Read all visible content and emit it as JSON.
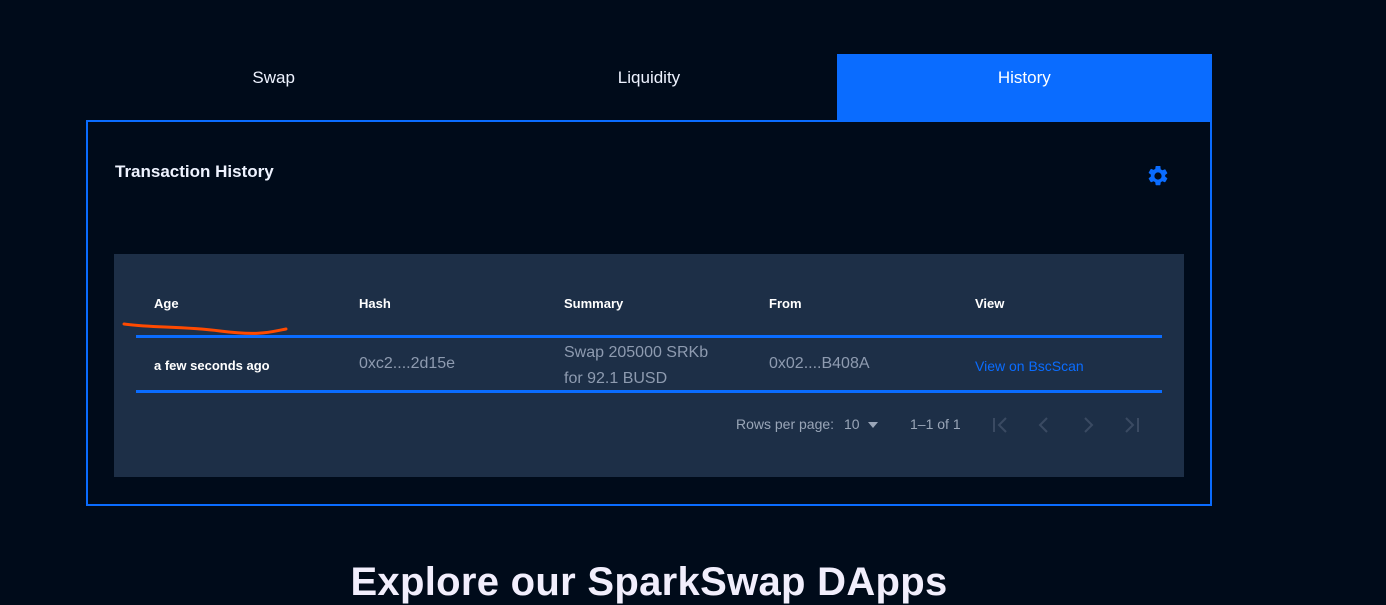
{
  "tabs": [
    {
      "label": "Swap"
    },
    {
      "label": "Liquidity"
    },
    {
      "label": "History"
    }
  ],
  "active_tab": "History",
  "panel": {
    "title": "Transaction History",
    "settings_icon": "gear-icon"
  },
  "table": {
    "columns": [
      "Age",
      "Hash",
      "Summary",
      "From",
      "View"
    ],
    "rows": [
      {
        "age": "a few seconds ago",
        "hash": "0xc2....2d15e",
        "summary_line1": "Swap 205000 SRKb",
        "summary_line2": "for 92.1 BUSD",
        "from": "0x02....B408A",
        "view": "View on BscScan"
      }
    ],
    "pagination": {
      "rows_per_page_label": "Rows per page:",
      "rows_per_page_value": "10",
      "range": "1–1 of 1"
    }
  },
  "annotation_color": "#ff4a00",
  "accent_color": "#0a6cff",
  "explore_heading": "Explore our SparkSwap DApps"
}
